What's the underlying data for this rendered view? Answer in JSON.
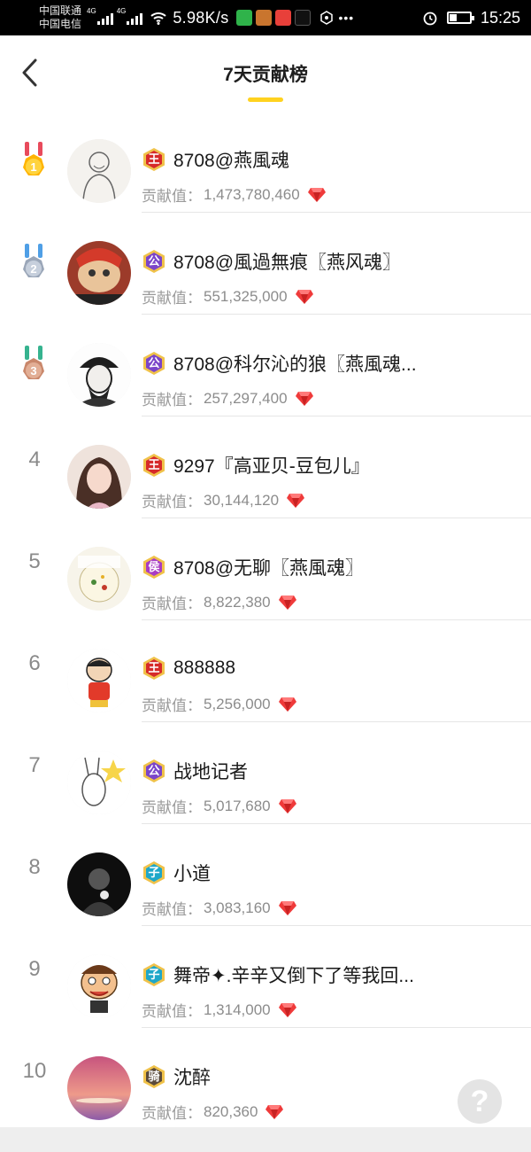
{
  "status_bar": {
    "carrier_1": "中国联通",
    "carrier_2": "中国电信",
    "network_1": "4G",
    "network_2": "4G",
    "speed": "5.98K/s",
    "time": "15:25"
  },
  "header": {
    "title": "7天贡献榜"
  },
  "score_label": "贡献值：",
  "colors": {
    "accent": "#ffd21f",
    "gem": "#ef3a3a",
    "badge_wang": "#d62a2a",
    "badge_gong": "#7b45c9",
    "badge_hou": "#a93cc4",
    "badge_zi": "#1ea7c9",
    "badge_qi": "#5a4a3a"
  },
  "ranking": [
    {
      "rank": "1",
      "medal": "gold",
      "badge": "王",
      "badge_type": "wang",
      "name": "8708@燕風魂",
      "score": "1,473,780,460"
    },
    {
      "rank": "2",
      "medal": "silver",
      "badge": "公",
      "badge_type": "gong",
      "name": "8708@風過無痕〖燕风魂〗",
      "score": "551,325,000"
    },
    {
      "rank": "3",
      "medal": "bronze",
      "badge": "公",
      "badge_type": "gong",
      "name": "8708@科尔沁的狼〖燕風魂...",
      "score": "257,297,400"
    },
    {
      "rank": "4",
      "medal": "",
      "badge": "王",
      "badge_type": "wang",
      "name": "9297『高亚贝-豆包儿』",
      "score": "30,144,120"
    },
    {
      "rank": "5",
      "medal": "",
      "badge": "侯",
      "badge_type": "hou",
      "name": "8708@无聊〖燕風魂〗",
      "score": "8,822,380"
    },
    {
      "rank": "6",
      "medal": "",
      "badge": "王",
      "badge_type": "wang",
      "name": "888888",
      "score": "5,256,000"
    },
    {
      "rank": "7",
      "medal": "",
      "badge": "公",
      "badge_type": "gong",
      "name": "战地记者",
      "score": "5,017,680"
    },
    {
      "rank": "8",
      "medal": "",
      "badge": "子",
      "badge_type": "zi",
      "name": "小道",
      "score": "3,083,160"
    },
    {
      "rank": "9",
      "medal": "",
      "badge": "子",
      "badge_type": "zi",
      "name": "舞帝✦.辛辛又倒下了等我回...",
      "score": "1,314,000"
    },
    {
      "rank": "10",
      "medal": "",
      "badge": "骑",
      "badge_type": "qi",
      "name": "沈醉",
      "score": "820,360"
    }
  ],
  "help_button": {
    "label": "?"
  }
}
